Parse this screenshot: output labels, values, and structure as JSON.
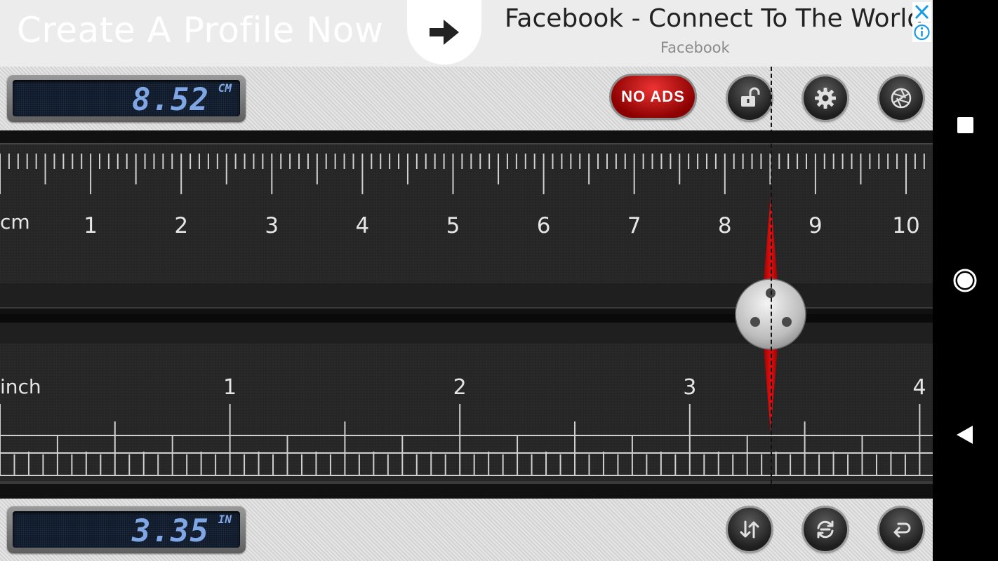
{
  "ad": {
    "headline": "Create A Profile Now",
    "title": "Facebook - Connect To The World",
    "source": "Facebook",
    "arrow_icon": "arrow-right-icon",
    "close_icon": "close-icon",
    "info_icon": "info-icon"
  },
  "top_display": {
    "value": "8.52",
    "unit": "CM"
  },
  "bottom_display": {
    "value": "3.35",
    "unit": "IN"
  },
  "toolbar": {
    "no_ads_label": "NO ADS",
    "lock_icon": "unlock-icon",
    "settings_icon": "gear-icon",
    "aperture_icon": "aperture-icon",
    "swap_icon": "swap-arrows-icon",
    "reset_icon": "refresh-icon",
    "back_icon": "return-icon"
  },
  "cm_ruler": {
    "unit_label": "cm",
    "labels": [
      "1",
      "2",
      "3",
      "4",
      "5",
      "6",
      "7",
      "8",
      "9",
      "10"
    ]
  },
  "inch_ruler": {
    "unit_label": "inch",
    "labels": [
      "1",
      "2",
      "3",
      "4"
    ]
  },
  "measurement": {
    "cm": 8.52,
    "inch": 3.35
  },
  "colors": {
    "lcd_text": "#7fa7e6",
    "needle": "#c40000",
    "no_ads": "#c00000"
  },
  "navbar": {
    "icons": [
      "square-icon",
      "circle-icon",
      "triangle-back-icon"
    ]
  }
}
